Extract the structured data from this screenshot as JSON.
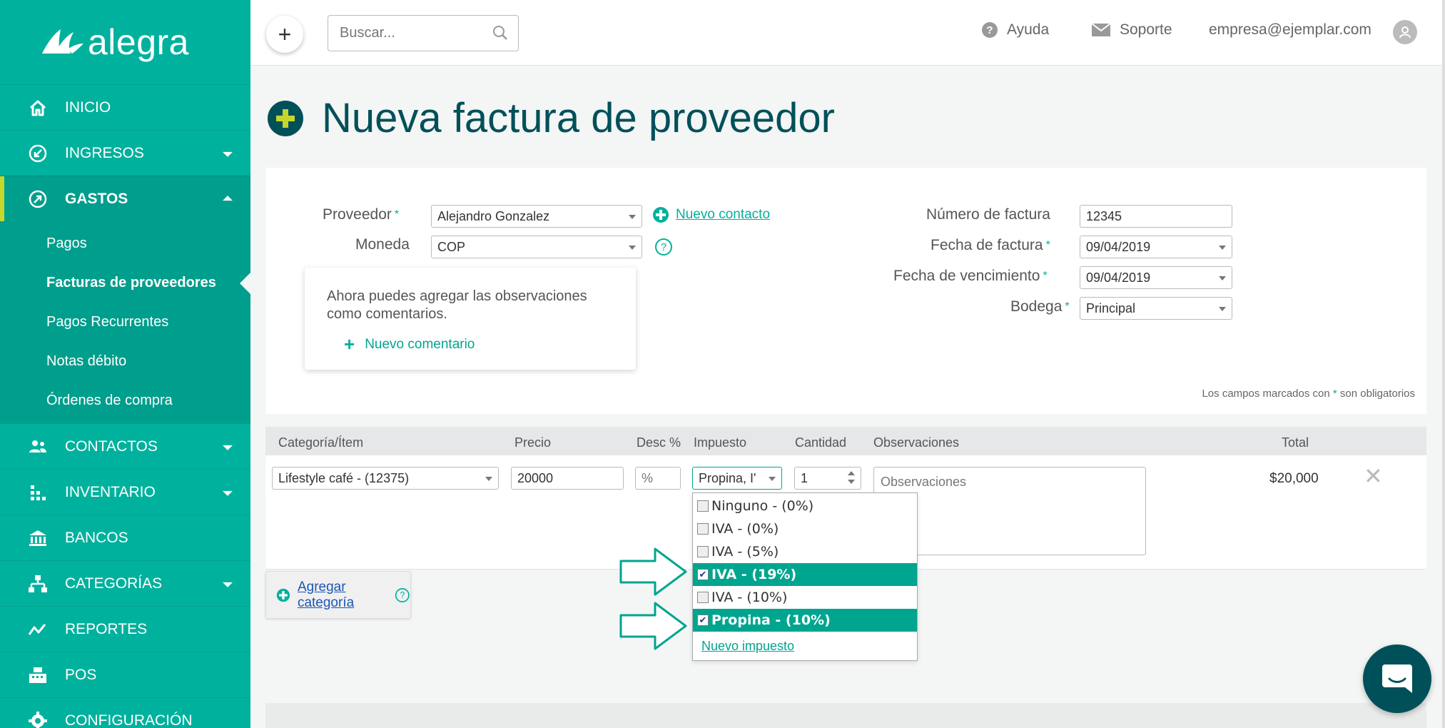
{
  "brand": {
    "name": "alegra"
  },
  "sidebar": {
    "items": [
      {
        "label": "INICIO",
        "icon": "home-icon"
      },
      {
        "label": "INGRESOS",
        "icon": "income-icon"
      },
      {
        "label": "GASTOS",
        "icon": "expenses-icon"
      },
      {
        "label": "CONTACTOS",
        "icon": "contacts-icon"
      },
      {
        "label": "INVENTARIO",
        "icon": "inventory-icon"
      },
      {
        "label": "BANCOS",
        "icon": "bank-icon"
      },
      {
        "label": "CATEGORÍAS",
        "icon": "categories-icon"
      },
      {
        "label": "REPORTES",
        "icon": "reports-icon"
      },
      {
        "label": "POS",
        "icon": "pos-icon"
      },
      {
        "label": "CONFIGURACIÓN",
        "icon": "gear-icon"
      }
    ],
    "gastos_sub": [
      "Pagos",
      "Facturas de proveedores",
      "Pagos Recurrentes",
      "Notas débito",
      "Órdenes de compra"
    ]
  },
  "topbar": {
    "add_label": "+",
    "search_placeholder": "Buscar...",
    "help_label": "Ayuda",
    "support_label": "Soporte",
    "user_email": "empresa@ejemplar.com"
  },
  "page": {
    "title": "Nueva factura de proveedor"
  },
  "form": {
    "proveedor_label": "Proveedor",
    "proveedor_value": "Alejandro Gonzalez",
    "nuevo_contacto": "Nuevo contacto",
    "moneda_label": "Moneda",
    "moneda_value": "COP",
    "numero_label": "Número de factura",
    "numero_value": "12345",
    "fecha_label": "Fecha de factura",
    "fecha_value": "09/04/2019",
    "vencimiento_label": "Fecha de vencimiento",
    "vencimiento_value": "09/04/2019",
    "bodega_label": "Bodega",
    "bodega_value": "Principal",
    "info_text": "Ahora puedes agregar las observaciones como comentarios.",
    "nuevo_comentario": "Nuevo comentario",
    "req_note_pre": "Los campos marcados con",
    "req_note_post": "son obligatorios",
    "required_mark": "*"
  },
  "table": {
    "headers": [
      "Categoría/Ítem",
      "Precio",
      "Desc %",
      "Impuesto",
      "Cantidad",
      "Observaciones",
      "Total"
    ],
    "row": {
      "item": "Lifestyle café - (12375)",
      "price": "20000",
      "discount_placeholder": "%",
      "tax": "Propina, I'",
      "quantity": "1",
      "obs_placeholder": "Observaciones",
      "total": "$20,000"
    },
    "add_category": "Agregar categoría"
  },
  "tax_dropdown": {
    "options": [
      {
        "label": "Ninguno - (0%)",
        "checked": false
      },
      {
        "label": "IVA - (0%)",
        "checked": false
      },
      {
        "label": "IVA - (5%)",
        "checked": false
      },
      {
        "label": "IVA - (19%)",
        "checked": true
      },
      {
        "label": "IVA - (10%)",
        "checked": false
      },
      {
        "label": "Propina - (10%)",
        "checked": true
      }
    ],
    "new_tax": "Nuevo impuesto"
  },
  "colors": {
    "sidebar": "#00b19d",
    "sidebar_active": "#009e8c",
    "accent_bar": "#c5d62c",
    "title": "#00505a",
    "highlight": "#00a58f"
  }
}
